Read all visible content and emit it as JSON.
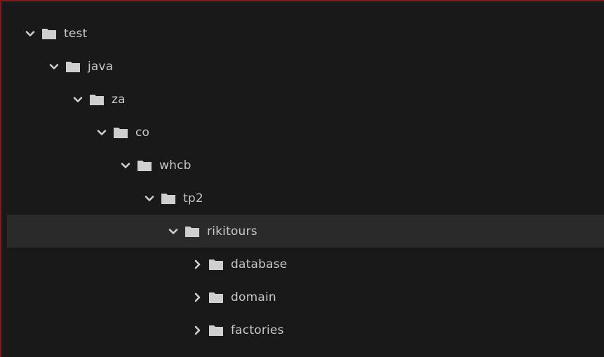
{
  "tree": {
    "items": [
      {
        "label": "test",
        "expanded": true,
        "chevron_icon": "chevron-down-icon",
        "folder_icon": "folder-icon",
        "selected": false
      },
      {
        "label": "java",
        "expanded": true,
        "chevron_icon": "chevron-down-icon",
        "folder_icon": "folder-icon",
        "selected": false
      },
      {
        "label": "za",
        "expanded": true,
        "chevron_icon": "chevron-down-icon",
        "folder_icon": "folder-icon",
        "selected": false
      },
      {
        "label": "co",
        "expanded": true,
        "chevron_icon": "chevron-down-icon",
        "folder_icon": "folder-icon",
        "selected": false
      },
      {
        "label": "whcb",
        "expanded": true,
        "chevron_icon": "chevron-down-icon",
        "folder_icon": "folder-icon",
        "selected": false
      },
      {
        "label": "tp2",
        "expanded": true,
        "chevron_icon": "chevron-down-icon",
        "folder_icon": "folder-icon",
        "selected": false
      },
      {
        "label": "rikitours",
        "expanded": true,
        "chevron_icon": "chevron-down-icon",
        "folder_icon": "folder-icon",
        "selected": true
      },
      {
        "label": "database",
        "expanded": false,
        "chevron_icon": "chevron-right-icon",
        "folder_icon": "folder-icon",
        "selected": false
      },
      {
        "label": "domain",
        "expanded": false,
        "chevron_icon": "chevron-right-icon",
        "folder_icon": "folder-icon",
        "selected": false
      },
      {
        "label": "factories",
        "expanded": false,
        "chevron_icon": "chevron-right-icon",
        "folder_icon": "folder-icon",
        "selected": false
      }
    ]
  },
  "colors": {
    "background": "#191919",
    "selected_row": "#2a2a2a",
    "text": "#c8c8c8",
    "icon": "#cfcfcf",
    "frame_border": "#7a1d1d"
  }
}
